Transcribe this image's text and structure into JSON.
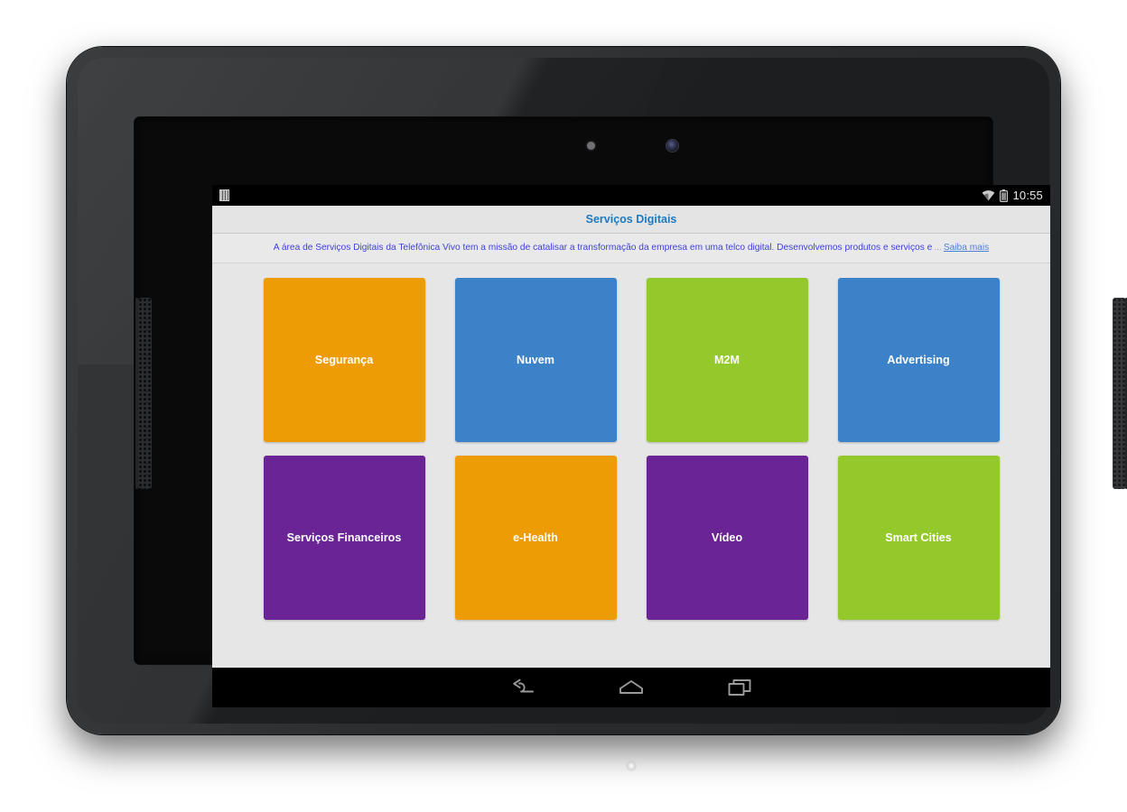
{
  "device": {
    "kind": "android-tablet",
    "sensors": [
      "proximity-sensor",
      "front-camera"
    ],
    "indicator": "charging-led"
  },
  "status_bar": {
    "notification_icon": "notification-glyph-icon",
    "wifi_icon": "wifi-icon",
    "battery_icon": "battery-icon",
    "time": "10:55"
  },
  "app": {
    "title": "Serviços Digitais"
  },
  "description": {
    "text": "A área de Serviços Digitais da Telefônica Vivo tem a missão de catalisar a transformação da empresa em uma telco digital. Desenvolvemos produtos e serviços e",
    "ellipsis": "...",
    "more_link": "Saiba mais"
  },
  "tiles": [
    {
      "label": "Segurança",
      "color": "#ed9c05"
    },
    {
      "label": "Nuvem",
      "color": "#3b82c9"
    },
    {
      "label": "M2M",
      "color": "#94c92b"
    },
    {
      "label": "Advertising",
      "color": "#3b82c9"
    },
    {
      "label": "Serviços Financeiros",
      "color": "#6b2496"
    },
    {
      "label": "e-Health",
      "color": "#ed9c05"
    },
    {
      "label": "Vídeo",
      "color": "#6b2496"
    },
    {
      "label": "Smart Cities",
      "color": "#94c92b"
    }
  ],
  "nav_bar": {
    "buttons": [
      {
        "name": "back-icon",
        "label": "Back"
      },
      {
        "name": "home-icon",
        "label": "Home"
      },
      {
        "name": "recent-apps-icon",
        "label": "Recent apps"
      }
    ]
  },
  "theme": {
    "title_color": "#1a7bc4",
    "description_color": "#3f3fdd",
    "link_color": "#4d7fd6",
    "screen_background": "#e6e6e6"
  }
}
